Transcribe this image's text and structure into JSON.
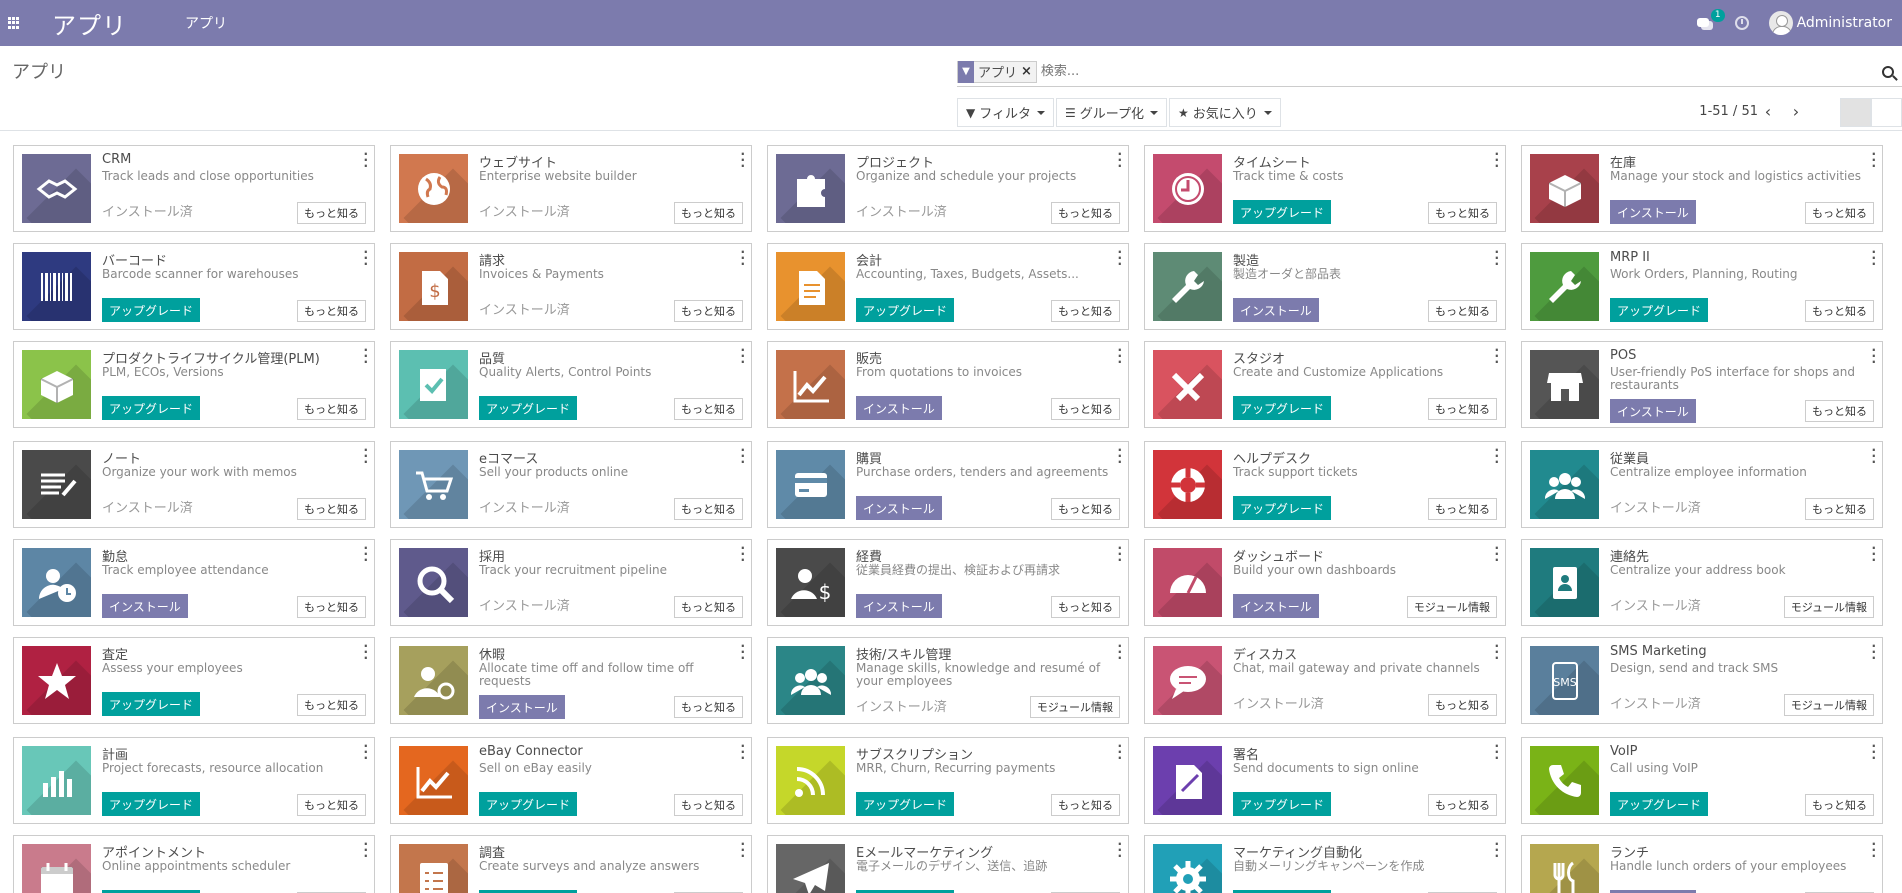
{
  "navbar": {
    "brand": "アプリ",
    "menu": "アプリ",
    "chat_count": "1",
    "user": "Administrator"
  },
  "control": {
    "title": "アプリ",
    "facet": "アプリ",
    "search_placeholder": "検索...",
    "filter_label": "フィルタ",
    "group_label": "グループ化",
    "favorite_label": "お気に入り",
    "pager": "1-51 / 51"
  },
  "labels": {
    "installed": "インストール済",
    "upgrade": "アップグレード",
    "install": "インストール",
    "learn_more": "もっと知る",
    "module_info": "モジュール情報"
  },
  "apps": [
    {
      "name": "CRM",
      "desc": "Track leads and close opportunities",
      "state": "installed",
      "more": "learn_more",
      "color": "#6d6b94",
      "glyph": "handshake"
    },
    {
      "name": "ウェブサイト",
      "desc": "Enterprise website builder",
      "state": "installed",
      "more": "learn_more",
      "color": "#d1784f",
      "glyph": "globe"
    },
    {
      "name": "プロジェクト",
      "desc": "Organize and schedule your projects",
      "state": "installed",
      "more": "learn_more",
      "color": "#6d6b94",
      "glyph": "puzzle"
    },
    {
      "name": "タイムシート",
      "desc": "Track time & costs",
      "state": "upgrade",
      "more": "learn_more",
      "color": "#c44b6e",
      "glyph": "clock"
    },
    {
      "name": "在庫",
      "desc": "Manage your stock and logistics activities",
      "state": "install",
      "more": "learn_more",
      "color": "#a8414b",
      "glyph": "box"
    },
    {
      "name": "バーコード",
      "desc": "Barcode scanner for warehouses",
      "state": "upgrade",
      "more": "learn_more",
      "color": "#2e3a80",
      "glyph": "barcode"
    },
    {
      "name": "請求",
      "desc": "Invoices & Payments",
      "state": "installed",
      "more": "learn_more",
      "color": "#c26c44",
      "glyph": "invoice"
    },
    {
      "name": "会計",
      "desc": "Accounting, Taxes, Budgets, Assets...",
      "state": "upgrade",
      "more": "learn_more",
      "color": "#e8922e",
      "glyph": "doc"
    },
    {
      "name": "製造",
      "desc": "製造オーダと部品表",
      "state": "install",
      "more": "learn_more",
      "color": "#5e8b75",
      "glyph": "wrench"
    },
    {
      "name": "MRP II",
      "desc": "Work Orders, Planning, Routing",
      "state": "upgrade",
      "more": "learn_more",
      "color": "#4e9b3e",
      "glyph": "wrench"
    },
    {
      "name": "プロダクトライフサイクル管理(PLM)",
      "desc": "PLM, ECOs, Versions",
      "state": "upgrade",
      "more": "learn_more",
      "color": "#8bc34a",
      "glyph": "box"
    },
    {
      "name": "品質",
      "desc": "Quality Alerts, Control Points",
      "state": "upgrade",
      "more": "learn_more",
      "color": "#5cbfb1",
      "glyph": "check"
    },
    {
      "name": "販売",
      "desc": "From quotations to invoices",
      "state": "install",
      "more": "learn_more",
      "color": "#c4714a",
      "glyph": "chart"
    },
    {
      "name": "スタジオ",
      "desc": "Create and Customize Applications",
      "state": "upgrade",
      "more": "learn_more",
      "color": "#d9535f",
      "glyph": "tools"
    },
    {
      "name": "POS",
      "desc": "User-friendly PoS interface for shops and restaurants",
      "state": "install",
      "more": "learn_more",
      "color": "#555555",
      "glyph": "shop"
    },
    {
      "name": "ノート",
      "desc": "Organize your work with memos",
      "state": "installed",
      "more": "learn_more",
      "color": "#4a4a4a",
      "glyph": "note"
    },
    {
      "name": "eコマース",
      "desc": "Sell your products online",
      "state": "installed",
      "more": "learn_more",
      "color": "#6f97b6",
      "glyph": "cart"
    },
    {
      "name": "購買",
      "desc": "Purchase orders, tenders and agreements",
      "state": "install",
      "more": "learn_more",
      "color": "#5f8aa8",
      "glyph": "card"
    },
    {
      "name": "ヘルプデスク",
      "desc": "Track support tickets",
      "state": "upgrade",
      "more": "learn_more",
      "color": "#d2343a",
      "glyph": "lifebuoy"
    },
    {
      "name": "従業員",
      "desc": "Centralize employee information",
      "state": "installed",
      "more": "learn_more",
      "color": "#218a8f",
      "glyph": "people"
    },
    {
      "name": "勤怠",
      "desc": "Track employee attendance",
      "state": "install",
      "more": "learn_more",
      "color": "#5d86a5",
      "glyph": "personclock"
    },
    {
      "name": "採用",
      "desc": "Track your recruitment pipeline",
      "state": "installed",
      "more": "learn_more",
      "color": "#5f5a8c",
      "glyph": "search"
    },
    {
      "name": "経費",
      "desc": "従業員経費の提出、検証および再請求",
      "state": "install",
      "more": "learn_more",
      "color": "#4a4a4a",
      "glyph": "personmoney"
    },
    {
      "name": "ダッシュボード",
      "desc": "Build your own dashboards",
      "state": "install",
      "more": "module_info",
      "color": "#c14b69",
      "glyph": "gauge"
    },
    {
      "name": "連絡先",
      "desc": "Centralize your address book",
      "state": "installed",
      "more": "module_info",
      "color": "#1f7b7e",
      "glyph": "contact"
    },
    {
      "name": "査定",
      "desc": "Assess your employees",
      "state": "upgrade",
      "more": "learn_more",
      "color": "#b02142",
      "glyph": "star"
    },
    {
      "name": "休暇",
      "desc": "Allocate time off and follow time off requests",
      "state": "install",
      "more": "learn_more",
      "color": "#a6a05d",
      "glyph": "personsun"
    },
    {
      "name": "技術/スキル管理",
      "desc": "Manage skills, knowledge and resumé of your employees",
      "state": "installed",
      "more": "module_info",
      "color": "#2b8687",
      "glyph": "people"
    },
    {
      "name": "ディスカス",
      "desc": "Chat, mail gateway and private channels",
      "state": "installed",
      "more": "learn_more",
      "color": "#c95474",
      "glyph": "chat"
    },
    {
      "name": "SMS Marketing",
      "desc": "Design, send and track SMS",
      "state": "installed",
      "more": "module_info",
      "color": "#5a7f9c",
      "glyph": "sms"
    },
    {
      "name": "計画",
      "desc": "Project forecasts, resource allocation",
      "state": "upgrade",
      "more": "learn_more",
      "color": "#68c7b8",
      "glyph": "bars"
    },
    {
      "name": "eBay Connector",
      "desc": "Sell on eBay easily",
      "state": "upgrade",
      "more": "learn_more",
      "color": "#e4671f",
      "glyph": "chart"
    },
    {
      "name": "サブスクリプション",
      "desc": "MRR, Churn, Recurring payments",
      "state": "upgrade",
      "more": "learn_more",
      "color": "#c5d72a",
      "glyph": "rss"
    },
    {
      "name": "署名",
      "desc": "Send documents to sign online",
      "state": "upgrade",
      "more": "learn_more",
      "color": "#6c3fae",
      "glyph": "sign"
    },
    {
      "name": "VoIP",
      "desc": "Call using VoIP",
      "state": "upgrade",
      "more": "learn_more",
      "color": "#7ab317",
      "glyph": "phone"
    },
    {
      "name": "アポイントメント",
      "desc": "Online appointments scheduler",
      "state": "upgrade",
      "more": "learn_more",
      "color": "#c97b8c",
      "glyph": "calendar"
    },
    {
      "name": "調査",
      "desc": "Create surveys and analyze answers",
      "state": "upgrade",
      "more": "learn_more",
      "color": "#c3764c",
      "glyph": "survey"
    },
    {
      "name": "Eメールマーケティング",
      "desc": "電子メールのデザイン、送信、追跡",
      "state": "upgrade",
      "more": "learn_more",
      "color": "#666666",
      "glyph": "plane"
    },
    {
      "name": "マーケティング自動化",
      "desc": "自動メーリングキャンペーンを作成",
      "state": "upgrade",
      "more": "learn_more",
      "color": "#21a0b7",
      "glyph": "gear"
    },
    {
      "name": "ランチ",
      "desc": "Handle lunch orders of your employees",
      "state": "install",
      "more": "learn_more",
      "color": "#b5a74f",
      "glyph": "fork"
    }
  ]
}
